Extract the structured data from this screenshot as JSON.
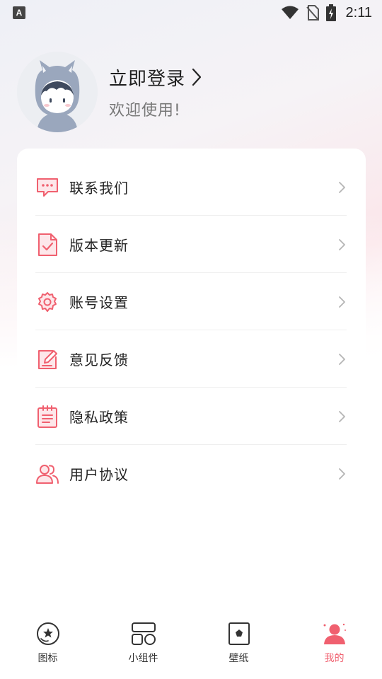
{
  "status_bar": {
    "time": "2:11",
    "left_icon_letter": "A"
  },
  "profile": {
    "login_label": "立即登录",
    "welcome_text": "欢迎使用!"
  },
  "menu": {
    "accent_color": "#f0606f",
    "items": [
      {
        "label": "联系我们",
        "icon": "chat-icon"
      },
      {
        "label": "版本更新",
        "icon": "update-document-icon"
      },
      {
        "label": "账号设置",
        "icon": "gear-icon"
      },
      {
        "label": "意见反馈",
        "icon": "feedback-edit-icon"
      },
      {
        "label": "隐私政策",
        "icon": "privacy-notepad-icon"
      },
      {
        "label": "用户协议",
        "icon": "users-icon"
      }
    ]
  },
  "bottom_nav": {
    "active_color": "#f0606f",
    "items": [
      {
        "label": "图标",
        "icon": "star-circle-icon",
        "active": false
      },
      {
        "label": "小组件",
        "icon": "widgets-icon",
        "active": false
      },
      {
        "label": "壁纸",
        "icon": "wallpaper-icon",
        "active": false
      },
      {
        "label": "我的",
        "icon": "profile-icon",
        "active": true
      }
    ]
  }
}
